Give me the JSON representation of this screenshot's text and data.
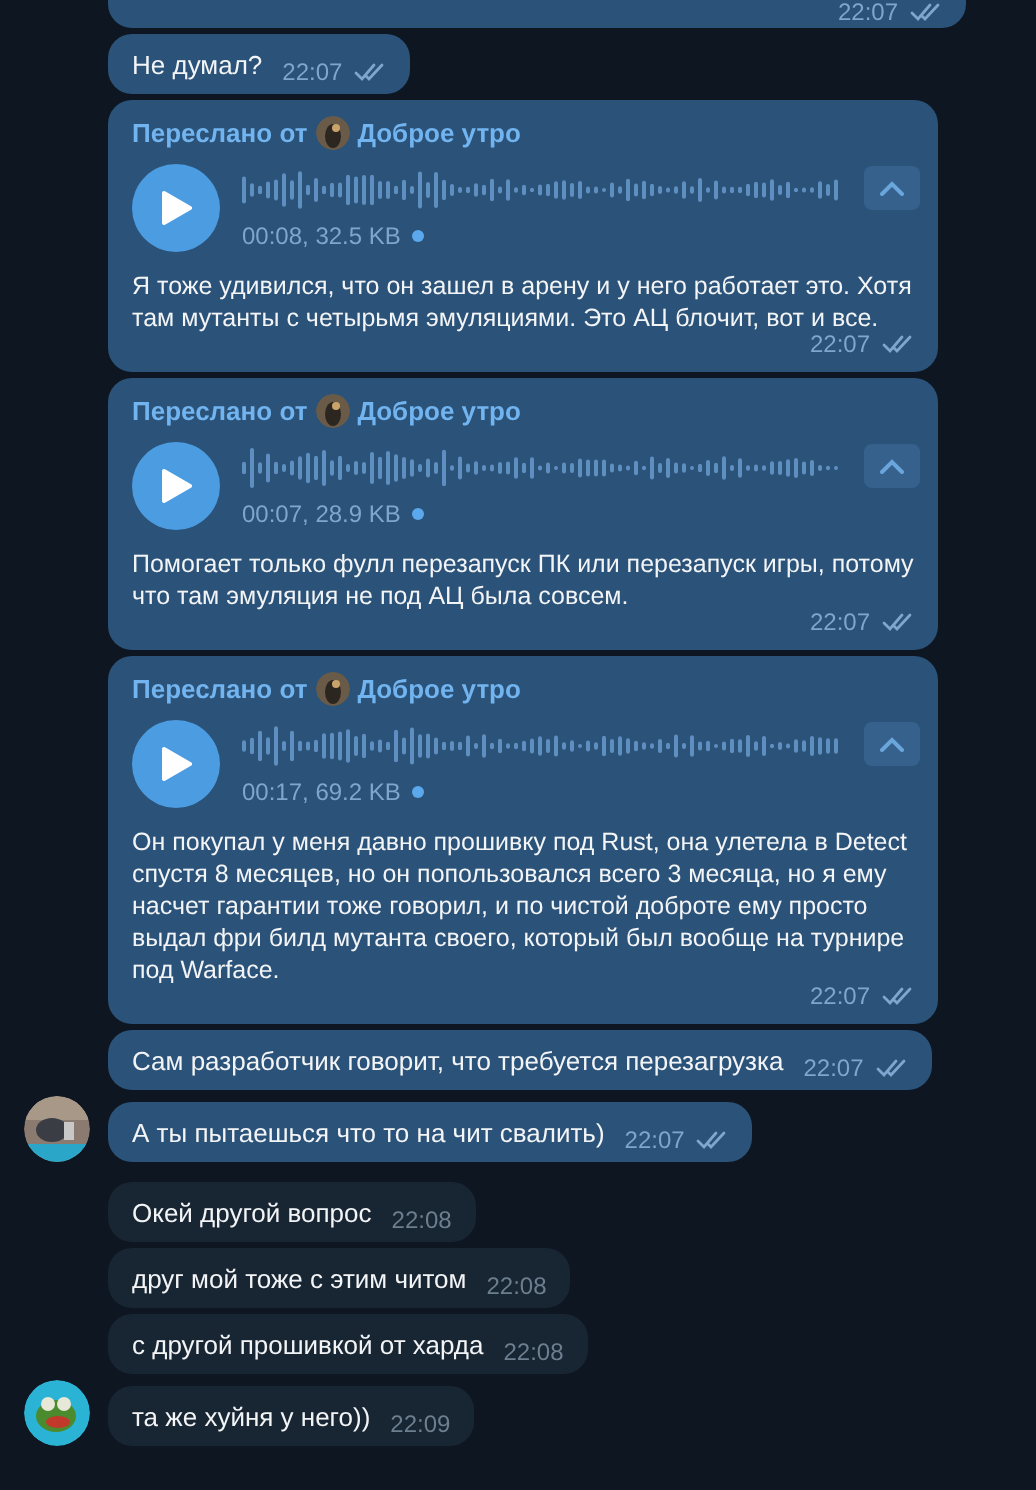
{
  "messages": [
    {
      "kind": "text",
      "outgoing": true,
      "cut": true,
      "time": "22:07",
      "read": true,
      "avatar": false
    },
    {
      "kind": "text",
      "outgoing": true,
      "text": "Не думал?",
      "time": "22:07",
      "read": true,
      "avatar": false
    },
    {
      "kind": "voice",
      "outgoing": true,
      "forward_label": "Переслано от",
      "forward_from": "Доброе утро",
      "duration": "00:08, 32.5 KB",
      "unlistened": true,
      "text": "Я тоже удивился, что он зашел в арену и у него работает это. Хотя там мутанты с четырьмя эмуляциями. Это АЦ блочит, вот и все.",
      "time": "22:07",
      "read": true,
      "avatar": false
    },
    {
      "kind": "voice",
      "outgoing": true,
      "forward_label": "Переслано от",
      "forward_from": "Доброе утро",
      "duration": "00:07, 28.9 KB",
      "unlistened": true,
      "text": "Помогает только фулл перезапуск ПК или перезапуск игры, потому что там эмуляция не под АЦ была совсем.",
      "time": "22:07",
      "read": true,
      "avatar": false
    },
    {
      "kind": "voice",
      "outgoing": true,
      "forward_label": "Переслано от",
      "forward_from": "Доброе утро",
      "duration": "00:17, 69.2 KB",
      "unlistened": true,
      "text": "Он покупал у меня давно прошивку под Rust, она улетела в Detect спустя 8 месяцев, но он попользовался всего 3 месяца, но я ему насчет гарантии тоже говорил, и по чистой доброте ему просто выдал фри билд мутанта своего, который был вообще на турнире под Warface.",
      "time": "22:07",
      "read": true,
      "avatar": false
    },
    {
      "kind": "text",
      "outgoing": true,
      "text": "Сам разработчик говорит, что требуется перезагрузка",
      "time": "22:07",
      "read": true,
      "avatar": false
    },
    {
      "kind": "text",
      "outgoing": true,
      "text": "А ты пытаешься что то на чит свалить)",
      "time": "22:07",
      "read": true,
      "avatar": true
    },
    {
      "kind": "text",
      "outgoing": false,
      "text": "Окей другой вопрос",
      "time": "22:08",
      "avatar": false
    },
    {
      "kind": "text",
      "outgoing": false,
      "text": "друг мой тоже с этим читом",
      "time": "22:08",
      "avatar": false
    },
    {
      "kind": "text",
      "outgoing": false,
      "text": "с другой прошивкой от харда",
      "time": "22:08",
      "avatar": false
    },
    {
      "kind": "text",
      "outgoing": false,
      "text": "та же хуйня у него))",
      "time": "22:09",
      "avatar": true
    }
  ]
}
